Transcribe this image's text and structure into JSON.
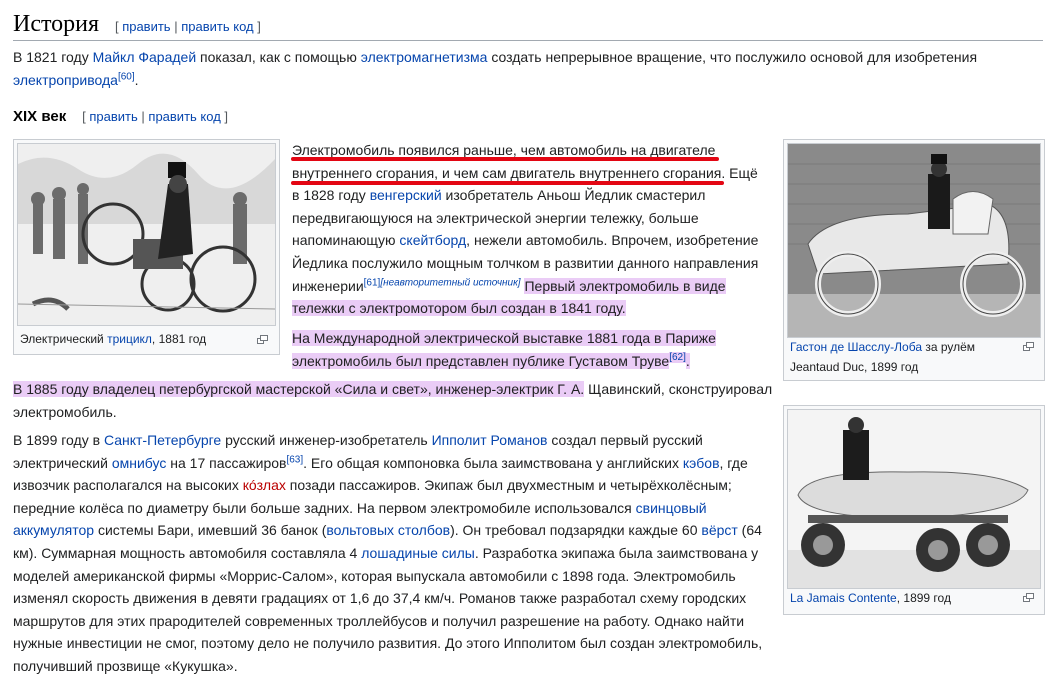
{
  "history": {
    "title": "История",
    "edit_open": "[",
    "edit_label": "править",
    "edit_sep": "|",
    "edit_code_label": "править код",
    "edit_close": "]"
  },
  "intro": {
    "t1": "В 1821 году ",
    "l1": "Майкл Фарадей",
    "t2": " показал, как с помощью ",
    "l2": "электромагнетизма",
    "t3": " создать непрерывное вращение, что послужило основой для изобретения",
    "l3": "электропривода",
    "ref": "[60]",
    "t4": "."
  },
  "section19": {
    "title": "XIX век",
    "edit_label": "править",
    "edit_code_label": "править код"
  },
  "p1": {
    "t1": "Электромобиль появился раньше, чем автомобиль на двигателе внутреннего сгорания, и чем сам двигатель внутреннего сгорания",
    "t2": ". Ещё в 1828 году ",
    "l1": "венгерский",
    "t3": " изобретатель Аньош Йедлик смастерил передвигающуюся на электрической энергии тележку, больше напоминающую ",
    "l2": "скейтборд",
    "t4": ", нежели автомобиль. Впрочем, изобретение Йедлика послужило мощным толчком в развитии данного направления инженерии",
    "ref": "[61]",
    "tag": "[неавторитетный источник]",
    "t5": " ",
    "hl": "Первый электромобиль в виде тележки с электромотором был создан в 1841 году."
  },
  "p2": {
    "hl": "На Международной электрической выставке 1881 года в Париже электромобиль был представлен публике Густавом Труве",
    "ref": "[62]",
    "t": "."
  },
  "p3": {
    "hl": "В 1885 году владелец петербургской мастерской «Сила и свет», инженер-электрик Г. А.",
    "t": " Щавинский, сконструировал электромобиль."
  },
  "p4": {
    "t1": "В 1899 году в ",
    "l1": "Санкт-Петербурге",
    "t2": " русский инженер-изобретатель ",
    "l2": "Ипполит Романов",
    "t3": " создал первый русский электрический ",
    "l3": "омнибус",
    "t4": " на 17 пассажиров",
    "ref": "[63]",
    "t5": ". Его общая компоновка была заимствована у английских ",
    "l4": "кэбов",
    "t6": ", где извозчик располагался на высоких ",
    "l5": "кóзлах",
    "t7": " позади пассажиров. Экипаж был двухместным и четырёхколёсным; передние колёса по диаметру были больше задних. На первом электромобиле использовался ",
    "l6": "свинцовый аккумулятор",
    "t8": " системы Бари, имевший 36 банок (",
    "l7": "вольтовых столбов",
    "t9": "). Он требовал подзарядки каждые 60 ",
    "l8": "вёрст",
    "t10": " (64 км). Суммарная мощность автомобиля составляла 4 ",
    "l9": "лошадиные силы",
    "t11": ". Разработка экипажа была заимствована у моделей американской фирмы «Моррис-Салом», которая выпускала автомобили с 1898 года. Электромобиль изменял скорость движения в девяти градациях от 1,6 до 37,4 км/ч. Романов также разработал схему городских маршрутов для этих прародителей современных троллейбусов и получил разрешение на работу. Однако найти нужные инвестиции не смог, поэтому дело не получило развития. До этого Ипполитом был создан электромобиль, получивший прозвище «Кукушка»."
  },
  "fig1": {
    "c1": "Электрический ",
    "l1": "трицикл",
    "c2": ", 1881 год"
  },
  "fig2": {
    "l1": "Гастон де Шасслу-Лоба",
    "c1": " за рулём Jeantaud Duc, 1899 год"
  },
  "fig3": {
    "l1": "La Jamais Contente",
    "c1": ", 1899 год"
  },
  "colors": {
    "link": "#0645ad",
    "highlight": "#eaccf6",
    "underline": "#e30613",
    "redlink": "#ba0000"
  },
  "icons": [
    "magnify-clip-icon"
  ]
}
